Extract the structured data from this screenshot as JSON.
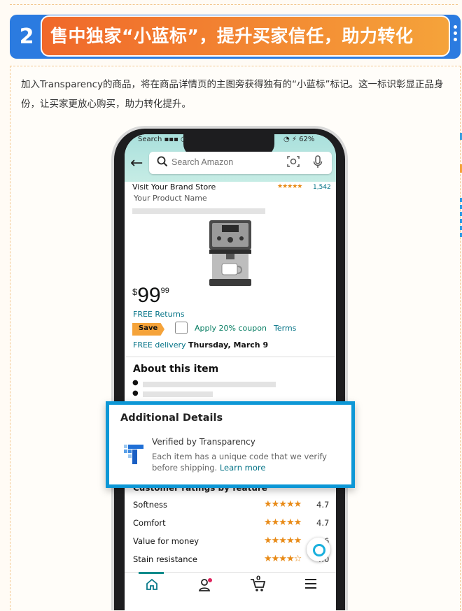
{
  "section": {
    "number": "2",
    "title": "售中独家“小蓝标”，提升买家信任，助力转化",
    "intro": "加入Transparency的商品，将在商品详情页的主图旁获得独有的“小蓝标”标记。这一标识彰显正品身份，让买家更放心购买，助力转化提升。"
  },
  "phone": {
    "status_left": "Search ▪▪▪ ◔",
    "status_right": "◔ ⚡ 62%",
    "search": {
      "placeholder": "Search Amazon"
    },
    "brand_link": "Visit Your Brand Store",
    "rating_stars": "★★★★★",
    "rating_count": "1,542",
    "product_name": "Your Product Name",
    "price": {
      "currency": "$",
      "dollars": "99",
      "cents": "99"
    },
    "free_returns": "FREE Returns",
    "save_label": "Save",
    "coupon_text": "Apply 20% coupon",
    "coupon_terms": "Terms",
    "delivery_prefix": "FREE delivery",
    "delivery_date": "Thursday, March 9",
    "about_title": "About this item",
    "additional_details": {
      "title": "Additional Details",
      "verified": "Verified by Transparency",
      "description": "Each item has a unique code that we verify before shipping.",
      "learn_more": "Learn more"
    },
    "ratings_heading": "Customer ratings by feature",
    "ratings": [
      {
        "feature": "Softness",
        "stars": "★★★★★",
        "score": "4.7"
      },
      {
        "feature": "Comfort",
        "stars": "★★★★★",
        "score": "4.7"
      },
      {
        "feature": "Value for money",
        "stars": "★★★★★",
        "score": "4.6"
      },
      {
        "feature": "Stain resistance",
        "stars": "★★★★☆",
        "score": "4.0"
      }
    ],
    "nav": [
      "home-icon",
      "account-icon",
      "cart-icon",
      "menu-icon"
    ],
    "cart_count": "0"
  },
  "colors": {
    "header_blue": "#2b7be0",
    "title_orange_start": "#f0682a",
    "title_orange_end": "#f5a33a",
    "highlight_blue": "#0d97d6",
    "link_teal": "#007185",
    "star_orange": "#e88a16"
  }
}
